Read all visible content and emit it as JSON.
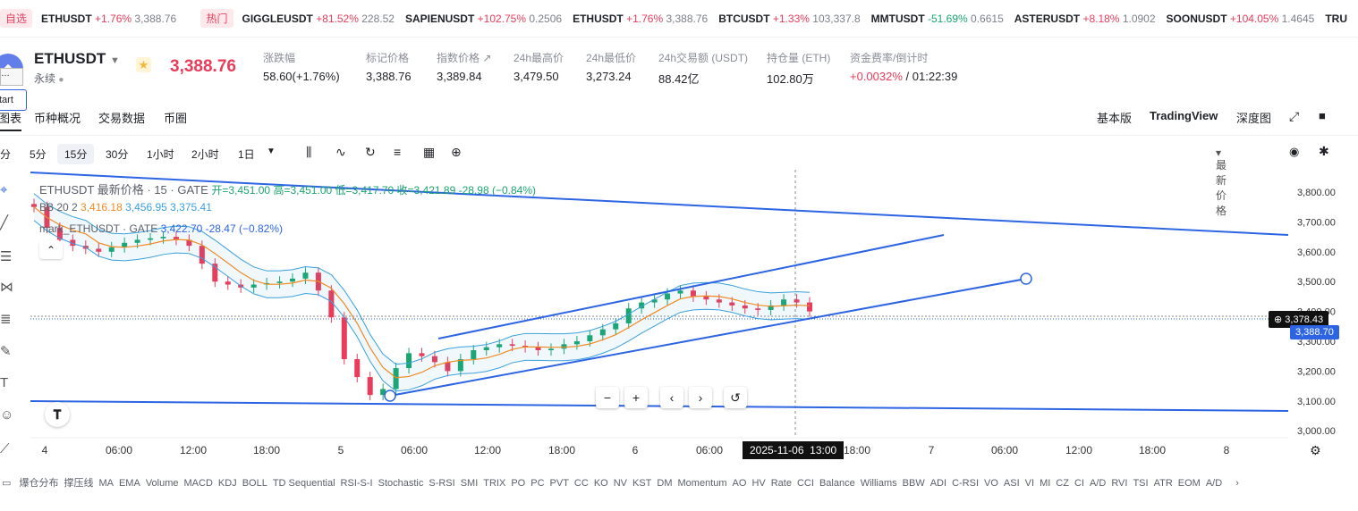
{
  "ticker": {
    "fav_tag": "自选",
    "fav": [
      {
        "sym": "ETHUSDT",
        "chg": "+1.76%",
        "price": "3,388.76",
        "dir": "up"
      }
    ],
    "hot_tag": "热门",
    "hot": [
      {
        "sym": "GIGGLEUSDT",
        "chg": "+81.52%",
        "price": "228.52",
        "dir": "up"
      },
      {
        "sym": "SAPIENUSDT",
        "chg": "+102.75%",
        "price": "0.2506",
        "dir": "up"
      },
      {
        "sym": "ETHUSDT",
        "chg": "+1.76%",
        "price": "3,388.76",
        "dir": "up"
      },
      {
        "sym": "BTCUSDT",
        "chg": "+1.33%",
        "price": "103,337.8",
        "dir": "up"
      },
      {
        "sym": "MMTUSDT",
        "chg": "-51.69%",
        "price": "0.6615",
        "dir": "dn"
      },
      {
        "sym": "ASTERUSDT",
        "chg": "+8.18%",
        "price": "1.0902",
        "dir": "up"
      },
      {
        "sym": "SOONUSDT",
        "chg": "+104.05%",
        "price": "1.4645",
        "dir": "up"
      },
      {
        "sym": "TRU",
        "chg": "",
        "price": "",
        "dir": "up"
      }
    ]
  },
  "header": {
    "symbol": "ETHUSDT",
    "contract": "永续",
    "price": "3,388.76",
    "stats": [
      {
        "label": "涨跌幅",
        "value": "58.60(+1.76%)",
        "color": "up"
      },
      {
        "label": "标记价格",
        "value": "3,388.76"
      },
      {
        "label": "指数价格 ↗",
        "value": "3,389.84"
      },
      {
        "label": "24h最高价",
        "value": "3,479.50"
      },
      {
        "label": "24h最低价",
        "value": "3,273.24"
      },
      {
        "label": "24h交易额 (USDT)",
        "value": "88.42亿"
      },
      {
        "label": "持仓量 (ETH)",
        "value": "102.80万"
      },
      {
        "label": "资金费率/倒计时",
        "value_up": "+0.0032%",
        "value_rest": "/ 01:22:39"
      }
    ]
  },
  "tabs": {
    "left": [
      "图表",
      "币种概况",
      "交易数据",
      "币圈"
    ],
    "right": [
      "基本版",
      "TradingView",
      "深度图"
    ]
  },
  "toolbar": {
    "timeframes": [
      "分",
      "5分",
      "15分",
      "30分",
      "1小时",
      "2小时",
      "1日"
    ],
    "active": "15分",
    "price_type": "最新价格"
  },
  "legend": {
    "line1_main": "ETHUSDT 最新价格 · 15 · GATE",
    "line1_ohlc": "开=3,451.00 高=3,451.00 低=3,417.70 收=3,421.89 -28.98 (−0.84%)",
    "bb_label": "BB 20 2",
    "bb_mid": "3,416.18",
    "bb_up": "3,456.95",
    "bb_low": "3,375.41",
    "mark_label": "mark_ETHUSDT · GATE",
    "mark_val": "3,422.70 -28.47 (−0.82%)"
  },
  "chart_data": {
    "type": "candlestick",
    "y_ticks": [
      "3,800.00",
      "3,700.00",
      "3,600.00",
      "3,500.00",
      "3,400.00",
      "3,300.00",
      "3,200.00",
      "3,100.00",
      "3,000.00"
    ],
    "x_ticks": [
      "4",
      "06:00",
      "12:00",
      "18:00",
      "5",
      "06:00",
      "12:00",
      "18:00",
      "6",
      "06:00",
      "12:00",
      "18:00",
      "7",
      "06:00",
      "12:00",
      "18:00",
      "8"
    ],
    "crosshair_time": "2025-11-06  13:00",
    "crosshair_price": "3,378.43",
    "last_price": "3,388.70",
    "closes": [
      3750,
      3680,
      3640,
      3620,
      3610,
      3600,
      3615,
      3630,
      3640,
      3645,
      3650,
      3640,
      3620,
      3560,
      3500,
      3490,
      3480,
      3490,
      3495,
      3500,
      3510,
      3530,
      3470,
      3380,
      3240,
      3180,
      3120,
      3140,
      3210,
      3260,
      3250,
      3230,
      3200,
      3240,
      3270,
      3280,
      3290,
      3285,
      3280,
      3270,
      3275,
      3290,
      3300,
      3320,
      3340,
      3360,
      3410,
      3430,
      3440,
      3460,
      3470,
      3450,
      3440,
      3430,
      3420,
      3410,
      3405,
      3420,
      3440,
      3430,
      3400
    ]
  },
  "indicators": [
    "爆仓分布",
    "撑压线",
    "MA",
    "EMA",
    "Volume",
    "MACD",
    "KDJ",
    "BOLL",
    "TD Sequential",
    "RSI-S-I",
    "Stochastic",
    "S-RSI",
    "SMI",
    "TRIX",
    "PO",
    "PC",
    "PVT",
    "CC",
    "KO",
    "NV",
    "KST",
    "DM",
    "Momentum",
    "AO",
    "HV",
    "Rate",
    "CCI",
    "Balance",
    "Williams",
    "BBW",
    "ADI",
    "C-RSI",
    "VO",
    "ASI",
    "VI",
    "MI",
    "CZ",
    "CI",
    "A/D",
    "RVI",
    "TSI",
    "ATR",
    "EOM",
    "A/D"
  ],
  "misc": {
    "start_tip": "tart"
  },
  "colors": {
    "up": "#ea3b5a",
    "down": "#1aa56f",
    "trend": "#2c64e3",
    "bb": "#3aa0dc",
    "ma": "#f08a24"
  }
}
